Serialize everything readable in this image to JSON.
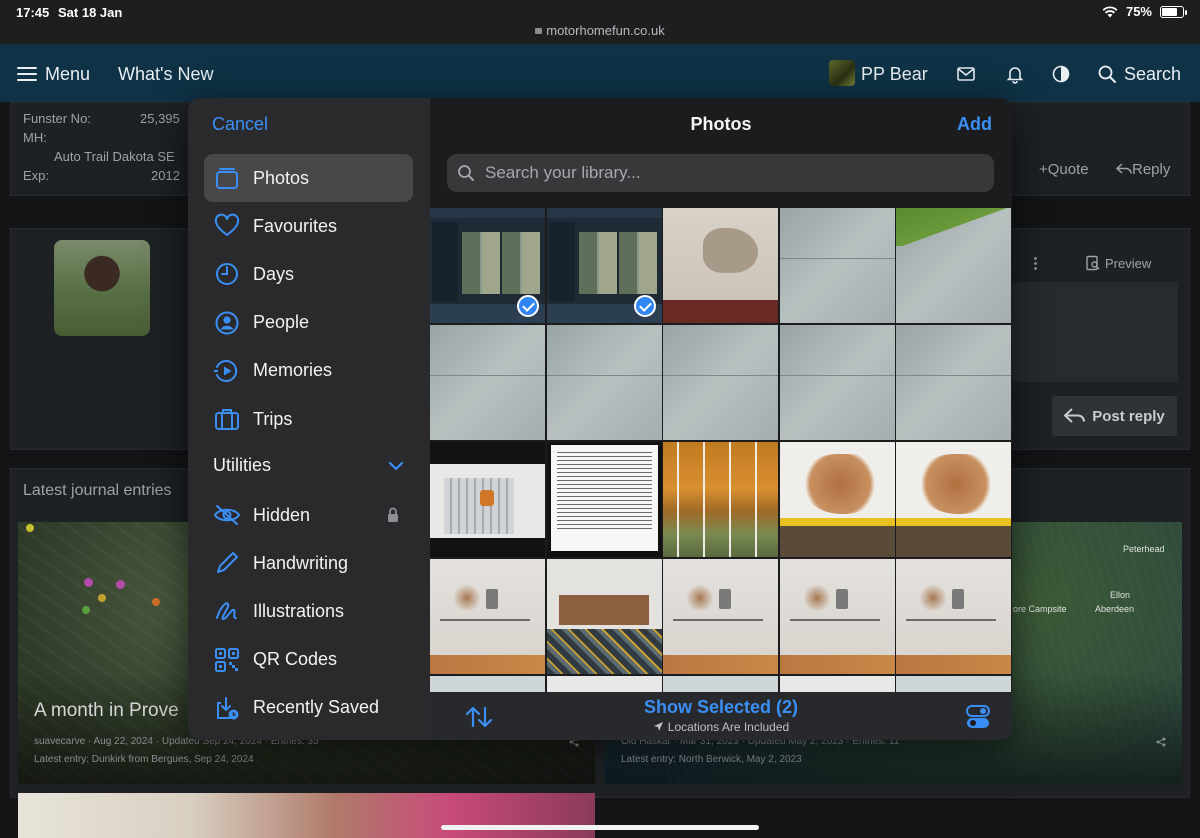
{
  "status_bar": {
    "time": "17:45",
    "date": "Sat 18 Jan",
    "url": "motorhomefun.co.uk",
    "battery": "75%",
    "battery_level": 0.75
  },
  "header": {
    "menu": "Menu",
    "whats_new": "What's New",
    "username": "PP Bear",
    "search": "Search"
  },
  "profile_card": {
    "rows": [
      {
        "label": "Funster No:",
        "value": "25,395"
      },
      {
        "label": "MH:",
        "value": ""
      },
      {
        "label": "",
        "value": "Auto Trail Dakota SE"
      },
      {
        "label": "Exp:",
        "value": "2012"
      }
    ],
    "quote": "Quote",
    "reply": "Reply"
  },
  "editor": {
    "preview": "Preview",
    "post_reply": "Post reply"
  },
  "journal": {
    "heading": "Latest journal entries",
    "left": {
      "title": "A month in Prove",
      "meta": "suavecarve · Aug 22, 2024 · Updated Sep 24, 2024 · Entries: 35",
      "latest": "Latest entry: Dunkirk from Bergues, Sep 24, 2024"
    },
    "right": {
      "meta": "Old Haskar · Mar 31, 2023 · Updated May 2, 2023 · Entries: 11",
      "latest": "Latest entry: North Berwick, May 2, 2023",
      "map_labels": [
        "Peterhead",
        "Ellon",
        "Aberdeen",
        "ore Campsite"
      ]
    }
  },
  "picker": {
    "cancel": "Cancel",
    "title": "Photos",
    "add": "Add",
    "search_placeholder": "Search your library...",
    "sidebar": [
      {
        "label": "Photos",
        "icon": "photos-icon",
        "active": true
      },
      {
        "label": "Favourites",
        "icon": "heart-icon"
      },
      {
        "label": "Days",
        "icon": "clock-icon"
      },
      {
        "label": "People",
        "icon": "person-icon"
      },
      {
        "label": "Memories",
        "icon": "memories-icon"
      },
      {
        "label": "Trips",
        "icon": "suitcase-icon"
      }
    ],
    "utilities_label": "Utilities",
    "utilities": [
      {
        "label": "Hidden",
        "icon": "eye-slash-icon",
        "locked": true
      },
      {
        "label": "Handwriting",
        "icon": "pencil-icon"
      },
      {
        "label": "Illustrations",
        "icon": "scribble-icon"
      },
      {
        "label": "QR Codes",
        "icon": "qr-code-icon"
      },
      {
        "label": "Recently Saved",
        "icon": "download-icon"
      }
    ],
    "show_selected": "Show Selected (2)",
    "locations": "Locations Are Included",
    "selected_count": 2,
    "photos": [
      {
        "kind": "screenshot",
        "selected": true
      },
      {
        "kind": "screenshot",
        "selected": true
      },
      {
        "kind": "wall-peeling"
      },
      {
        "kind": "grey-panel"
      },
      {
        "kind": "grey-panel-grass"
      },
      {
        "kind": "grey-panel"
      },
      {
        "kind": "grey-panel"
      },
      {
        "kind": "grey-panel"
      },
      {
        "kind": "grey-panel"
      },
      {
        "kind": "grey-panel"
      },
      {
        "kind": "pipes"
      },
      {
        "kind": "document"
      },
      {
        "kind": "autumn-park"
      },
      {
        "kind": "stained-wall"
      },
      {
        "kind": "stained-wall"
      },
      {
        "kind": "under-sink"
      },
      {
        "kind": "under-sink-tools"
      },
      {
        "kind": "under-sink"
      },
      {
        "kind": "under-sink"
      },
      {
        "kind": "under-sink"
      }
    ]
  },
  "colors": {
    "accent": "#3a8ff6",
    "header_bg": "#0f3246",
    "sidebar_bg": "#2a2a2c"
  }
}
